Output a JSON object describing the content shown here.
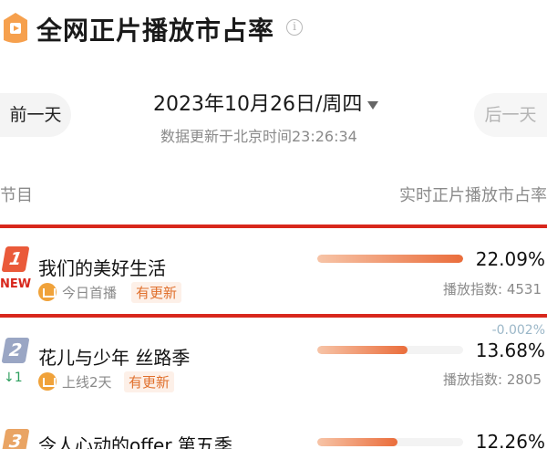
{
  "header": {
    "title": "全网正片播放市占率",
    "info_icon": "info-circle-icon",
    "logo_icon": "app-logo-icon"
  },
  "date_bar": {
    "prev_label": "前一天",
    "date_label": "2023年10月26日/周四",
    "next_label": "后一天",
    "update_text": "数据更新于北京时间23:26:34"
  },
  "columns": {
    "left": "节目",
    "right": "实时正片播放市占率"
  },
  "accent_color": "#d8271c",
  "bar_color": "#ea6d3b",
  "rows": [
    {
      "rank": "1",
      "rank_color": "#ea5a3a",
      "badge": "NEW",
      "title": "我们的美好生活",
      "meta": "今日首播",
      "tag": "有更新",
      "share": "22.09%",
      "share_value": 22.09,
      "index_text": "播放指数: 4531",
      "highlighted": true
    },
    {
      "rank": "2",
      "rank_color": "#9aa6c4",
      "change": "↓1",
      "delta": "-0.002%",
      "title": "花儿与少年 丝路季",
      "meta": "上线2天",
      "tag": "有更新",
      "share": "13.68%",
      "share_value": 13.68,
      "index_text": "播放指数: 2805",
      "highlighted": false
    },
    {
      "rank": "3",
      "rank_color": "#e9a464",
      "title": "令人心动的offer 第五季",
      "share": "12.26%",
      "share_value": 12.26,
      "highlighted": false
    }
  ]
}
